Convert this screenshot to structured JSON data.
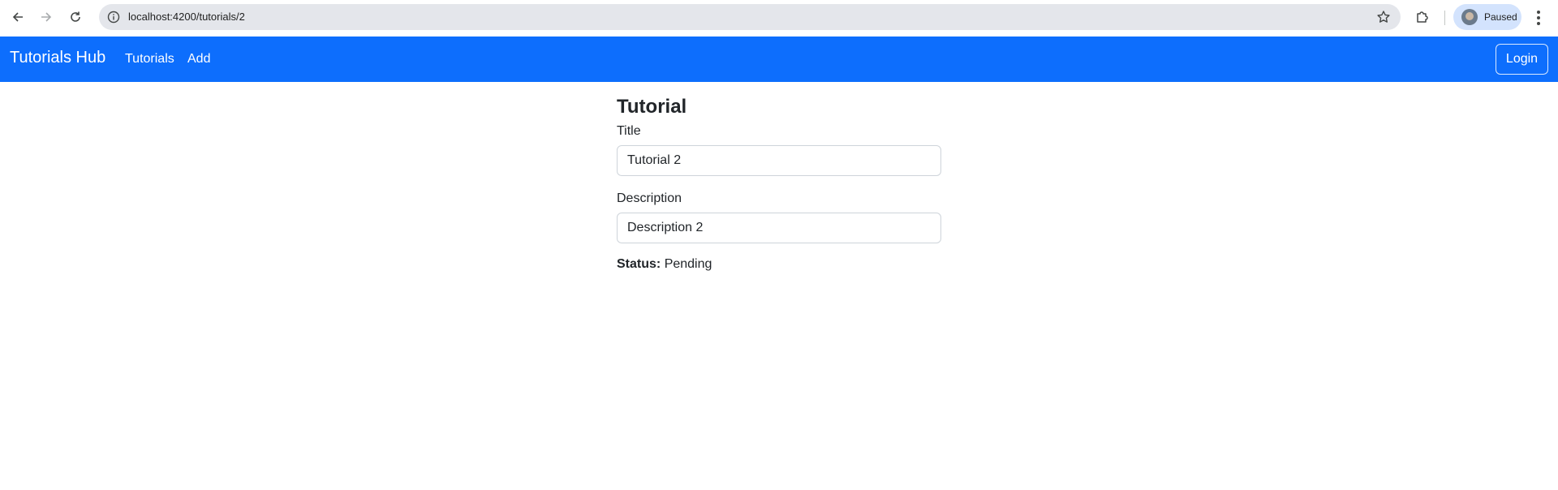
{
  "browser": {
    "url": "localhost:4200/tutorials/2",
    "profile_status": "Paused"
  },
  "navbar": {
    "brand": "Tutorials Hub",
    "links": [
      "Tutorials",
      "Add"
    ],
    "login_label": "Login",
    "color": "#0d6efd"
  },
  "tutorial": {
    "heading": "Tutorial",
    "title_label": "Title",
    "title_value": "Tutorial 2",
    "description_label": "Description",
    "description_value": "Description 2",
    "status_label": "Status:",
    "status_value": "Pending"
  }
}
